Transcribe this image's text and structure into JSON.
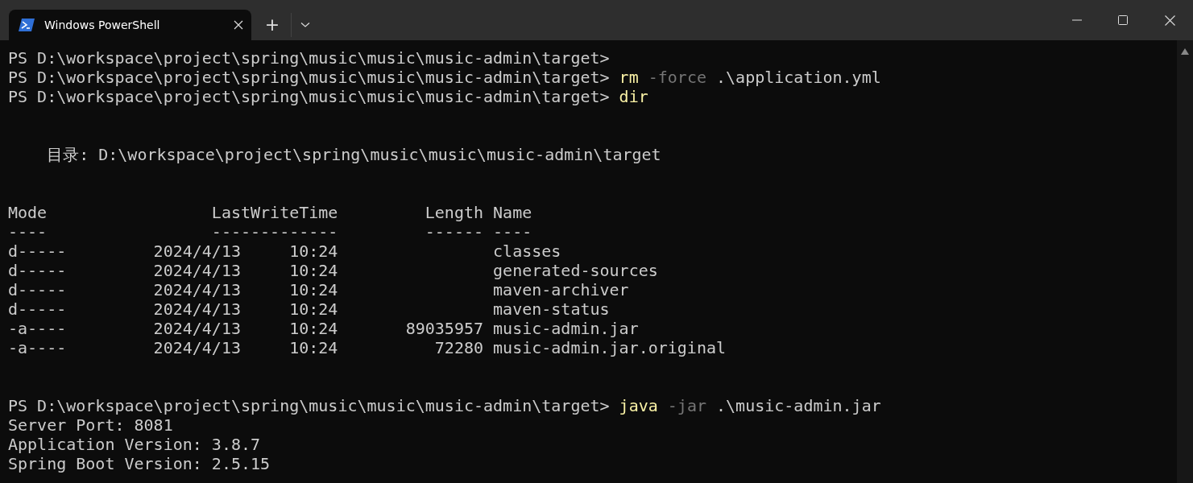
{
  "tab": {
    "title": "Windows PowerShell",
    "selected": true
  },
  "new_tab": "+",
  "lines": [
    {
      "kind": "text",
      "segments": [
        {
          "kind": "plain",
          "text": "PS D:\\workspace\\project\\spring\\music\\music\\music-admin\\target>"
        }
      ]
    },
    {
      "kind": "text",
      "segments": [
        {
          "kind": "plain",
          "text": "PS D:\\workspace\\project\\spring\\music\\music\\music-admin\\target> "
        },
        {
          "kind": "command",
          "text": "rm"
        },
        {
          "kind": "parameter",
          "text": " -force"
        },
        {
          "kind": "plain",
          "text": " .\\application.yml"
        }
      ]
    },
    {
      "kind": "text",
      "segments": [
        {
          "kind": "plain",
          "text": "PS D:\\workspace\\project\\spring\\music\\music\\music-admin\\target> "
        },
        {
          "kind": "command",
          "text": "dir"
        }
      ]
    },
    {
      "kind": "blank"
    },
    {
      "kind": "blank"
    },
    {
      "kind": "text",
      "segments": [
        {
          "kind": "plain",
          "text": "    目录: D:\\workspace\\project\\spring\\music\\music\\music-admin\\target"
        }
      ]
    },
    {
      "kind": "blank"
    },
    {
      "kind": "blank"
    },
    {
      "kind": "text",
      "segments": [
        {
          "kind": "plain",
          "text": "Mode                 LastWriteTime         Length Name"
        }
      ]
    },
    {
      "kind": "text",
      "segments": [
        {
          "kind": "plain",
          "text": "----                 -------------         ------ ----"
        }
      ]
    },
    {
      "kind": "text",
      "segments": [
        {
          "kind": "plain",
          "text": "d-----         2024/4/13     10:24                classes"
        }
      ]
    },
    {
      "kind": "text",
      "segments": [
        {
          "kind": "plain",
          "text": "d-----         2024/4/13     10:24                generated-sources"
        }
      ]
    },
    {
      "kind": "text",
      "segments": [
        {
          "kind": "plain",
          "text": "d-----         2024/4/13     10:24                maven-archiver"
        }
      ]
    },
    {
      "kind": "text",
      "segments": [
        {
          "kind": "plain",
          "text": "d-----         2024/4/13     10:24                maven-status"
        }
      ]
    },
    {
      "kind": "text",
      "segments": [
        {
          "kind": "plain",
          "text": "-a----         2024/4/13     10:24       89035957 music-admin.jar"
        }
      ]
    },
    {
      "kind": "text",
      "segments": [
        {
          "kind": "plain",
          "text": "-a----         2024/4/13     10:24          72280 music-admin.jar.original"
        }
      ]
    },
    {
      "kind": "blank"
    },
    {
      "kind": "blank"
    },
    {
      "kind": "text",
      "segments": [
        {
          "kind": "plain",
          "text": "PS D:\\workspace\\project\\spring\\music\\music\\music-admin\\target> "
        },
        {
          "kind": "command",
          "text": "java"
        },
        {
          "kind": "parameter",
          "text": " -jar"
        },
        {
          "kind": "plain",
          "text": " .\\music-admin.jar"
        }
      ]
    },
    {
      "kind": "text",
      "segments": [
        {
          "kind": "plain",
          "text": "Server Port: 8081"
        }
      ]
    },
    {
      "kind": "text",
      "segments": [
        {
          "kind": "plain",
          "text": "Application Version: 3.8.7"
        }
      ]
    },
    {
      "kind": "text",
      "segments": [
        {
          "kind": "plain",
          "text": "Spring Boot Version: 2.5.15"
        }
      ]
    }
  ]
}
